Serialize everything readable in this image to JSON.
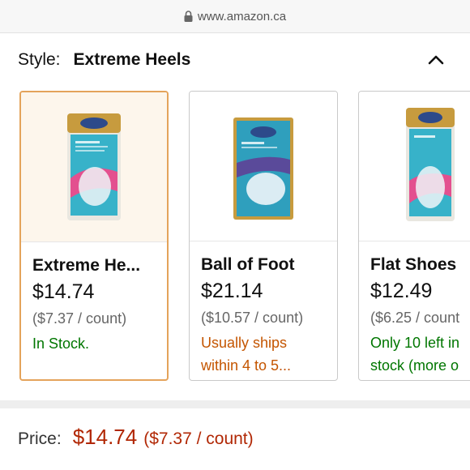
{
  "browser": {
    "url": "www.amazon.ca"
  },
  "style": {
    "label": "Style:",
    "value": "Extreme Heels"
  },
  "options": [
    {
      "name": "Extreme He...",
      "price": "$14.74",
      "unit_price": "($7.37 / count)",
      "availability": "In Stock.",
      "availability_color": "#007600",
      "selected": true
    },
    {
      "name": "Ball of Foot",
      "price": "$21.14",
      "unit_price": "($10.57 / count)",
      "availability": "Usually ships within 4 to 5...",
      "availability_color": "#c45500",
      "selected": false
    },
    {
      "name": "Flat Shoes",
      "price": "$12.49",
      "unit_price": "($6.25 / count",
      "availability": "Only 10 left in stock (more o",
      "availability_color": "#007600",
      "selected": false
    }
  ],
  "summary": {
    "label": "Price:",
    "price": "$14.74",
    "unit_price": "($7.37 / count)"
  },
  "colors": {
    "price": "#b12704",
    "selected_border": "#e4a35b",
    "in_stock": "#007600",
    "ships_later": "#c45500"
  }
}
